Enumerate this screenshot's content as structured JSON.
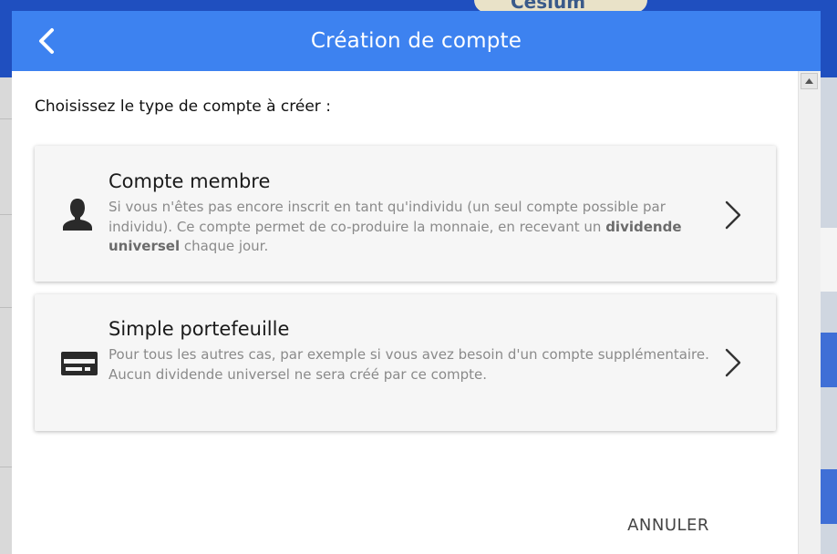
{
  "background": {
    "logo_text": "Cesium"
  },
  "header": {
    "title": "Création de compte",
    "back_icon": "chevron-left-icon"
  },
  "prompt": "Choisissez le type de compte à créer :",
  "options": [
    {
      "title": "Compte membre",
      "icon": "person-icon",
      "desc_part1": "Si vous n'êtes pas encore inscrit en tant qu'individu (un seul compte possible par individu). Ce compte permet de co-produire la monnaie, en recevant un ",
      "desc_bold": "dividende universel",
      "desc_part2": " chaque jour."
    },
    {
      "title": "Simple portefeuille",
      "icon": "wallet-card-icon",
      "desc_line1": "Pour tous les autres cas, par exemple si vous avez besoin d'un compte supplémentaire.",
      "desc_line2": "Aucun dividende universel ne sera créé par ce compte."
    }
  ],
  "footer": {
    "cancel_label": "ANNULER"
  },
  "colors": {
    "header_bg": "#3d82f0",
    "card_bg": "#f6f6f6"
  }
}
